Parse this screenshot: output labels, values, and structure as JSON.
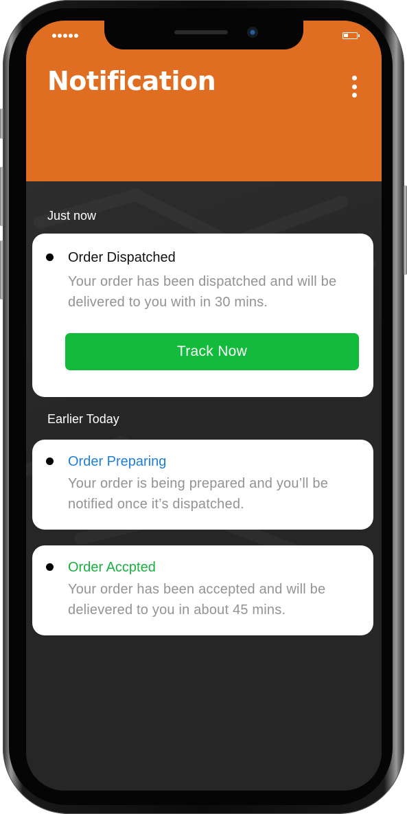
{
  "header": {
    "title": "Notification",
    "menu_icon": "more-vertical-icon",
    "background_color": "#df6e22"
  },
  "status_bar": {
    "signal_icon": "signal-dots-icon",
    "battery_icon": "battery-icon"
  },
  "sections": [
    {
      "label": "Just now",
      "notifications": [
        {
          "title": "Order Dispatched",
          "title_color": "#111111",
          "body": "Your order has been dispatched and will be delivered to you with in 30 mins.",
          "action_label": "Track Now",
          "action_color": "#12bb3b"
        }
      ]
    },
    {
      "label": "Earlier Today",
      "notifications": [
        {
          "title": "Order Preparing",
          "title_color": "#1f7fd6",
          "body": "Your order is being prepared and you’ll be notified once it’s dispatched."
        },
        {
          "title": "Order Accpted",
          "title_color": "#18b03f",
          "body": "Your order has been accepted and will be delievered to you in about 45 mins."
        }
      ]
    }
  ]
}
